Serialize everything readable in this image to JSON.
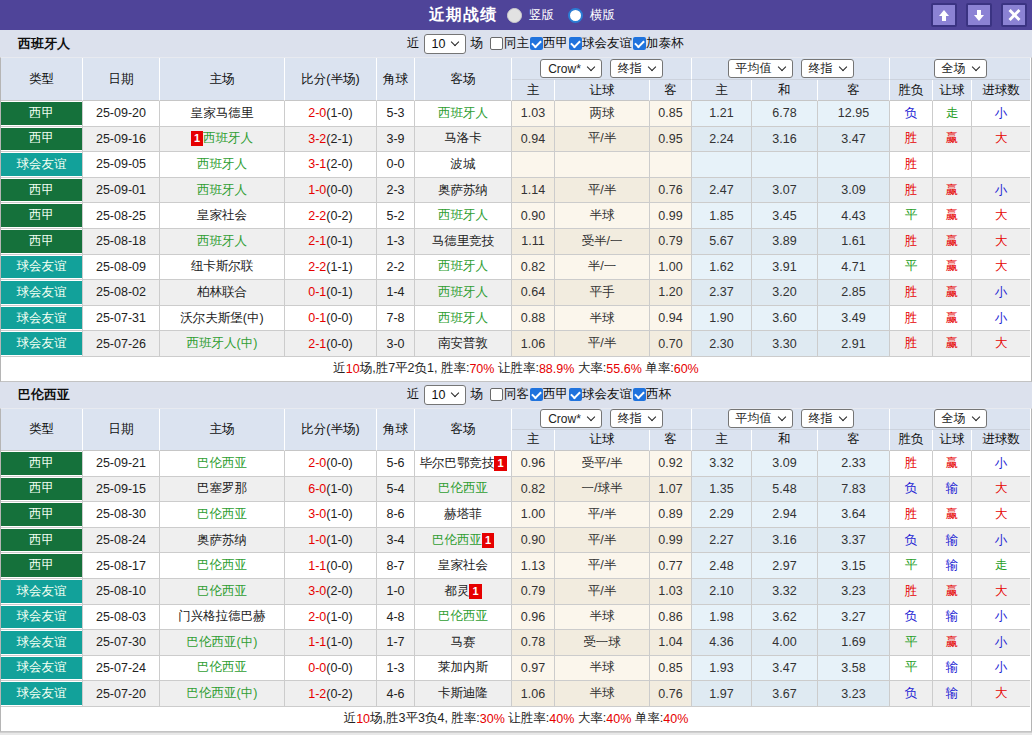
{
  "titlebar": {
    "title": "近期战绩",
    "radios": [
      {
        "label": "竖版",
        "selected": true
      },
      {
        "label": "横版",
        "selected": false
      }
    ],
    "buttons": [
      {
        "name": "move-up"
      },
      {
        "name": "move-down"
      },
      {
        "name": "close"
      }
    ]
  },
  "colors": {
    "titlebar_bg": "#4f4499",
    "button_bg": "#8b82d4",
    "band_bg": "#dce1ed",
    "header_bg": "#dbe3f0",
    "league_badge": "#15713b",
    "friendly_badge": "#12a19a",
    "team_green": "#2f9e32",
    "score_red": "#e60000",
    "win_red": "#e60000",
    "lose_blue": "#2323d4",
    "draw_green": "#1f9e1f",
    "odds_bg": "#fbf6ec",
    "avg_bg": "#e7f2f9",
    "checkbox_blue": "#2073dd"
  },
  "sections": [
    {
      "team": "西班牙人",
      "controls": {
        "prefix": "近",
        "count": "10",
        "suffix": "场",
        "filters": [
          {
            "label": "同主",
            "checked": false
          },
          {
            "label": "西甲",
            "checked": true
          },
          {
            "label": "球会友谊",
            "checked": true
          },
          {
            "label": "加泰杯",
            "checked": true
          }
        ]
      },
      "head": {
        "cols": [
          "类型",
          "日期",
          "主场",
          "比分(半场)",
          "角球",
          "客场"
        ],
        "sub": [
          "主",
          "让球",
          "客",
          "主",
          "和",
          "客",
          "胜负",
          "让球",
          "进球数"
        ],
        "selects": [
          "Crow*",
          "终指",
          "平均值",
          "终指",
          "全场"
        ]
      },
      "rows": [
        {
          "type": "西甲",
          "tc": "league",
          "date": "25-09-20",
          "home": "皇家马德里",
          "hg": false,
          "score": "2-0",
          "half": "(1-0)",
          "corner": "5-3",
          "away": "西班牙人",
          "ag": true,
          "odds": [
            "1.03",
            "两球",
            "0.85"
          ],
          "avg": [
            "1.21",
            "6.78",
            "12.95"
          ],
          "res": [
            "负",
            "b"
          ],
          "han": [
            "走",
            "g"
          ],
          "goal": [
            "小",
            "b"
          ]
        },
        {
          "type": "西甲",
          "tc": "league",
          "date": "25-09-16",
          "home": "西班牙人",
          "hg": true,
          "hbadge": "1",
          "score": "3-2",
          "half": "(2-1)",
          "corner": "3-9",
          "away": "马洛卡",
          "ag": false,
          "odds": [
            "0.94",
            "平/半",
            "0.95"
          ],
          "avg": [
            "2.24",
            "3.16",
            "3.47"
          ],
          "res": [
            "胜",
            "r"
          ],
          "han": [
            "赢",
            "r"
          ],
          "goal": [
            "大",
            "r"
          ]
        },
        {
          "type": "球会友谊",
          "tc": "friendly",
          "date": "25-09-05",
          "home": "西班牙人",
          "hg": true,
          "score": "3-1",
          "half": "(2-0)",
          "corner": "0-0",
          "away": "波城",
          "ag": false,
          "odds": [
            "",
            "",
            ""
          ],
          "avg": [
            "",
            "",
            ""
          ],
          "res": [
            "胜",
            "r"
          ],
          "han": [
            "",
            ""
          ],
          "goal": [
            "",
            ""
          ]
        },
        {
          "type": "西甲",
          "tc": "league",
          "date": "25-09-01",
          "home": "西班牙人",
          "hg": true,
          "score": "1-0",
          "half": "(0-0)",
          "corner": "2-3",
          "away": "奥萨苏纳",
          "ag": false,
          "odds": [
            "1.14",
            "平/半",
            "0.76"
          ],
          "avg": [
            "2.47",
            "3.07",
            "3.09"
          ],
          "res": [
            "胜",
            "r"
          ],
          "han": [
            "赢",
            "r"
          ],
          "goal": [
            "小",
            "b"
          ]
        },
        {
          "type": "西甲",
          "tc": "league",
          "date": "25-08-25",
          "home": "皇家社会",
          "hg": false,
          "score": "2-2",
          "half": "(0-2)",
          "corner": "5-2",
          "away": "西班牙人",
          "ag": true,
          "odds": [
            "0.90",
            "半球",
            "0.99"
          ],
          "avg": [
            "1.85",
            "3.45",
            "4.43"
          ],
          "res": [
            "平",
            "g"
          ],
          "han": [
            "赢",
            "r"
          ],
          "goal": [
            "大",
            "r"
          ]
        },
        {
          "type": "西甲",
          "tc": "league",
          "date": "25-08-18",
          "home": "西班牙人",
          "hg": true,
          "score": "2-1",
          "half": "(0-1)",
          "corner": "1-3",
          "away": "马德里竞技",
          "ag": false,
          "odds": [
            "1.11",
            "受半/一",
            "0.79"
          ],
          "avg": [
            "5.67",
            "3.89",
            "1.61"
          ],
          "res": [
            "胜",
            "r"
          ],
          "han": [
            "赢",
            "r"
          ],
          "goal": [
            "大",
            "r"
          ]
        },
        {
          "type": "球会友谊",
          "tc": "friendly",
          "date": "25-08-09",
          "home": "纽卡斯尔联",
          "hg": false,
          "score": "2-2",
          "half": "(1-1)",
          "corner": "2-2",
          "away": "西班牙人",
          "ag": true,
          "odds": [
            "0.82",
            "半/一",
            "1.00"
          ],
          "avg": [
            "1.62",
            "3.91",
            "4.71"
          ],
          "res": [
            "平",
            "g"
          ],
          "han": [
            "赢",
            "r"
          ],
          "goal": [
            "大",
            "r"
          ]
        },
        {
          "type": "球会友谊",
          "tc": "friendly",
          "date": "25-08-02",
          "home": "柏林联合",
          "hg": false,
          "score": "0-1",
          "half": "(0-1)",
          "corner": "1-4",
          "away": "西班牙人",
          "ag": true,
          "odds": [
            "0.64",
            "平手",
            "1.20"
          ],
          "avg": [
            "2.37",
            "3.20",
            "2.85"
          ],
          "res": [
            "胜",
            "r"
          ],
          "han": [
            "赢",
            "r"
          ],
          "goal": [
            "小",
            "b"
          ]
        },
        {
          "type": "球会友谊",
          "tc": "friendly",
          "date": "25-07-31",
          "home": "沃尔夫斯堡(中)",
          "hg": false,
          "score": "0-1",
          "half": "(0-0)",
          "corner": "7-8",
          "away": "西班牙人",
          "ag": true,
          "odds": [
            "0.88",
            "半球",
            "0.94"
          ],
          "avg": [
            "1.90",
            "3.60",
            "3.49"
          ],
          "res": [
            "胜",
            "r"
          ],
          "han": [
            "赢",
            "r"
          ],
          "goal": [
            "小",
            "b"
          ]
        },
        {
          "type": "球会友谊",
          "tc": "friendly",
          "date": "25-07-26",
          "home": "西班牙人(中)",
          "hg": true,
          "score": "2-1",
          "half": "(0-0)",
          "corner": "3-0",
          "away": "南安普敦",
          "ag": false,
          "odds": [
            "1.06",
            "平/半",
            "0.70"
          ],
          "avg": [
            "2.30",
            "3.30",
            "2.91"
          ],
          "res": [
            "胜",
            "r"
          ],
          "han": [
            "赢",
            "r"
          ],
          "goal": [
            "大",
            "r"
          ]
        }
      ],
      "summary": [
        [
          "近",
          "k"
        ],
        [
          "10",
          "r"
        ],
        [
          "场,胜7平2负1, 胜率:",
          "k"
        ],
        [
          "70%",
          "r"
        ],
        [
          " 让胜率:",
          "k"
        ],
        [
          "88.9%",
          "r"
        ],
        [
          " 大率:",
          "k"
        ],
        [
          "55.6%",
          "r"
        ],
        [
          " 单率:",
          "k"
        ],
        [
          "60%",
          "r"
        ]
      ]
    },
    {
      "team": "巴伦西亚",
      "controls": {
        "prefix": "近",
        "count": "10",
        "suffix": "场",
        "filters": [
          {
            "label": "同客",
            "checked": false
          },
          {
            "label": "西甲",
            "checked": true
          },
          {
            "label": "球会友谊",
            "checked": true
          },
          {
            "label": "西杯",
            "checked": true
          }
        ]
      },
      "head": {
        "cols": [
          "类型",
          "日期",
          "主场",
          "比分(半场)",
          "角球",
          "客场"
        ],
        "sub": [
          "主",
          "让球",
          "客",
          "主",
          "和",
          "客",
          "胜负",
          "让球",
          "进球数"
        ],
        "selects": [
          "Crow*",
          "终指",
          "平均值",
          "终指",
          "全场"
        ]
      },
      "rows": [
        {
          "type": "西甲",
          "tc": "league",
          "date": "25-09-21",
          "home": "巴伦西亚",
          "hg": true,
          "score": "2-0",
          "half": "(0-0)",
          "corner": "5-6",
          "away": "毕尔巴鄂竞技",
          "ag": false,
          "abadge": "1",
          "odds": [
            "0.96",
            "受平/半",
            "0.92"
          ],
          "avg": [
            "3.32",
            "3.09",
            "2.33"
          ],
          "res": [
            "胜",
            "r"
          ],
          "han": [
            "赢",
            "r"
          ],
          "goal": [
            "小",
            "b"
          ]
        },
        {
          "type": "西甲",
          "tc": "league",
          "date": "25-09-15",
          "home": "巴塞罗那",
          "hg": false,
          "score": "6-0",
          "half": "(1-0)",
          "corner": "5-4",
          "away": "巴伦西亚",
          "ag": true,
          "odds": [
            "0.82",
            "一/球半",
            "1.07"
          ],
          "avg": [
            "1.35",
            "5.48",
            "7.83"
          ],
          "res": [
            "负",
            "b"
          ],
          "han": [
            "输",
            "b"
          ],
          "goal": [
            "大",
            "r"
          ]
        },
        {
          "type": "西甲",
          "tc": "league",
          "date": "25-08-30",
          "home": "巴伦西亚",
          "hg": true,
          "score": "3-0",
          "half": "(1-0)",
          "corner": "8-6",
          "away": "赫塔菲",
          "ag": false,
          "odds": [
            "1.00",
            "平/半",
            "0.89"
          ],
          "avg": [
            "2.29",
            "2.94",
            "3.64"
          ],
          "res": [
            "胜",
            "r"
          ],
          "han": [
            "赢",
            "r"
          ],
          "goal": [
            "大",
            "r"
          ]
        },
        {
          "type": "西甲",
          "tc": "league",
          "date": "25-08-24",
          "home": "奥萨苏纳",
          "hg": false,
          "score": "1-0",
          "half": "(1-0)",
          "corner": "3-4",
          "away": "巴伦西亚",
          "ag": true,
          "abadge": "1",
          "odds": [
            "0.90",
            "平/半",
            "0.99"
          ],
          "avg": [
            "2.27",
            "3.16",
            "3.37"
          ],
          "res": [
            "负",
            "b"
          ],
          "han": [
            "输",
            "b"
          ],
          "goal": [
            "小",
            "b"
          ]
        },
        {
          "type": "西甲",
          "tc": "league",
          "date": "25-08-17",
          "home": "巴伦西亚",
          "hg": true,
          "score": "1-1",
          "half": "(0-0)",
          "corner": "8-7",
          "away": "皇家社会",
          "ag": false,
          "odds": [
            "1.13",
            "平/半",
            "0.77"
          ],
          "avg": [
            "2.48",
            "2.97",
            "3.15"
          ],
          "res": [
            "平",
            "g"
          ],
          "han": [
            "输",
            "b"
          ],
          "goal": [
            "走",
            "g"
          ]
        },
        {
          "type": "球会友谊",
          "tc": "friendly",
          "date": "25-08-10",
          "home": "巴伦西亚",
          "hg": true,
          "score": "3-0",
          "half": "(2-0)",
          "corner": "1-0",
          "away": "都灵",
          "ag": false,
          "abadge": "1",
          "odds": [
            "0.79",
            "平/半",
            "1.03"
          ],
          "avg": [
            "2.10",
            "3.32",
            "3.23"
          ],
          "res": [
            "胜",
            "r"
          ],
          "han": [
            "赢",
            "r"
          ],
          "goal": [
            "大",
            "r"
          ]
        },
        {
          "type": "球会友谊",
          "tc": "friendly",
          "date": "25-08-03",
          "home": "门兴格拉德巴赫",
          "hg": false,
          "score": "2-0",
          "half": "(1-0)",
          "corner": "4-8",
          "away": "巴伦西亚",
          "ag": true,
          "odds": [
            "0.96",
            "半球",
            "0.86"
          ],
          "avg": [
            "1.98",
            "3.62",
            "3.27"
          ],
          "res": [
            "负",
            "b"
          ],
          "han": [
            "输",
            "b"
          ],
          "goal": [
            "小",
            "b"
          ]
        },
        {
          "type": "球会友谊",
          "tc": "friendly",
          "date": "25-07-30",
          "home": "巴伦西亚(中)",
          "hg": true,
          "score": "1-1",
          "half": "(1-0)",
          "corner": "1-7",
          "away": "马赛",
          "ag": false,
          "odds": [
            "0.78",
            "受一球",
            "1.04"
          ],
          "avg": [
            "4.36",
            "4.00",
            "1.69"
          ],
          "res": [
            "平",
            "g"
          ],
          "han": [
            "赢",
            "r"
          ],
          "goal": [
            "小",
            "b"
          ]
        },
        {
          "type": "球会友谊",
          "tc": "friendly",
          "date": "25-07-24",
          "home": "巴伦西亚",
          "hg": true,
          "score": "0-0",
          "half": "(0-0)",
          "corner": "1-3",
          "away": "莱加内斯",
          "ag": false,
          "odds": [
            "0.97",
            "半球",
            "0.85"
          ],
          "avg": [
            "1.93",
            "3.47",
            "3.58"
          ],
          "res": [
            "平",
            "g"
          ],
          "han": [
            "输",
            "b"
          ],
          "goal": [
            "小",
            "b"
          ]
        },
        {
          "type": "球会友谊",
          "tc": "friendly",
          "date": "25-07-20",
          "home": "巴伦西亚(中)",
          "hg": true,
          "score": "1-2",
          "half": "(0-2)",
          "corner": "4-6",
          "away": "卡斯迪隆",
          "ag": false,
          "odds": [
            "1.06",
            "半球",
            "0.76"
          ],
          "avg": [
            "1.97",
            "3.67",
            "3.23"
          ],
          "res": [
            "负",
            "b"
          ],
          "han": [
            "输",
            "b"
          ],
          "goal": [
            "大",
            "r"
          ]
        }
      ],
      "summary": [
        [
          "近",
          "k"
        ],
        [
          "10",
          "r"
        ],
        [
          "场,胜3平3负4, 胜率:",
          "k"
        ],
        [
          "30%",
          "r"
        ],
        [
          " 让胜率:",
          "k"
        ],
        [
          "40%",
          "r"
        ],
        [
          " 大率:",
          "k"
        ],
        [
          "40%",
          "r"
        ],
        [
          " 单率:",
          "k"
        ],
        [
          "40%",
          "r"
        ]
      ]
    }
  ]
}
